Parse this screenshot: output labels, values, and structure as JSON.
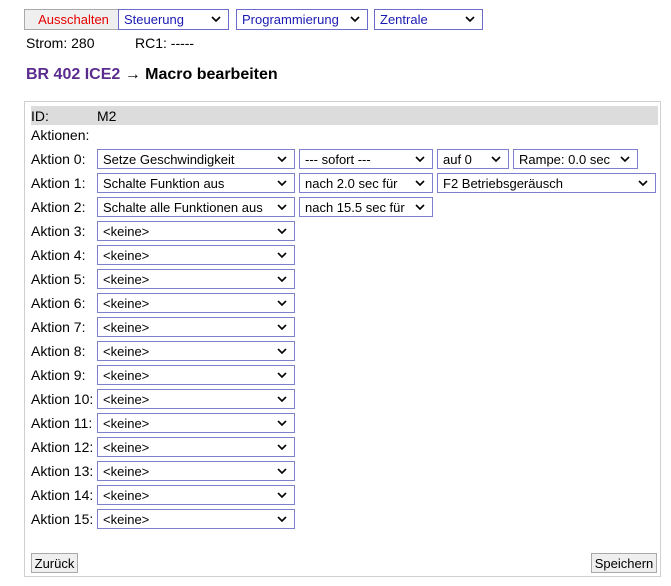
{
  "toolbar": {
    "off_label": "Ausschalten",
    "menus": [
      "Steuerung",
      "Programmierung",
      "Zentrale"
    ]
  },
  "status": {
    "strom": "Strom: 280",
    "rc1": "RC1: -----"
  },
  "title": {
    "loco": "BR 402 ICE2",
    "arrow": "→",
    "text": "Macro bearbeiten"
  },
  "macro": {
    "id_label": "ID:",
    "id_value": "M2",
    "actions_label": "Aktionen:",
    "rows": [
      {
        "label": "Aktion 0:",
        "action": "Setze Geschwindigkeit",
        "timing": "--- sofort ---",
        "value": "auf 0",
        "extra": "Rampe: 0.0 sec"
      },
      {
        "label": "Aktion 1:",
        "action": "Schalte Funktion aus",
        "timing": "nach 2.0 sec für",
        "value": "F2 Betriebsgeräusch"
      },
      {
        "label": "Aktion 2:",
        "action": "Schalte alle Funktionen aus",
        "timing": "nach 15.5 sec für"
      },
      {
        "label": "Aktion 3:",
        "action": "<keine>"
      },
      {
        "label": "Aktion 4:",
        "action": "<keine>"
      },
      {
        "label": "Aktion 5:",
        "action": "<keine>"
      },
      {
        "label": "Aktion 6:",
        "action": "<keine>"
      },
      {
        "label": "Aktion 7:",
        "action": "<keine>"
      },
      {
        "label": "Aktion 8:",
        "action": "<keine>"
      },
      {
        "label": "Aktion 9:",
        "action": "<keine>"
      },
      {
        "label": "Aktion 10:",
        "action": "<keine>"
      },
      {
        "label": "Aktion 11:",
        "action": "<keine>"
      },
      {
        "label": "Aktion 12:",
        "action": "<keine>"
      },
      {
        "label": "Aktion 13:",
        "action": "<keine>"
      },
      {
        "label": "Aktion 14:",
        "action": "<keine>"
      },
      {
        "label": "Aktion 15:",
        "action": "<keine>"
      }
    ]
  },
  "buttons": {
    "back": "Zurück",
    "save": "Speichern"
  }
}
